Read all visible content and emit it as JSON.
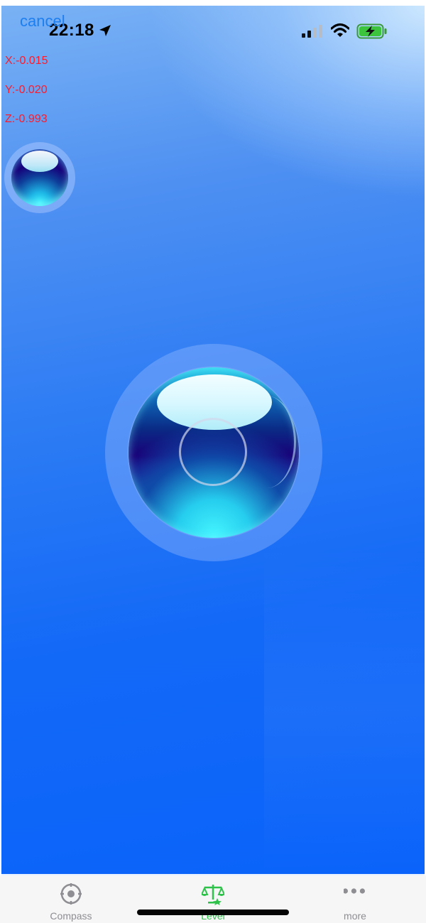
{
  "status_bar": {
    "time": "22:18",
    "location_icon": "location-arrow-icon",
    "signal_icon": "cellular-signal-icon",
    "wifi_icon": "wifi-icon",
    "battery_icon": "battery-charging-icon"
  },
  "header": {
    "cancel_label": "cancel"
  },
  "sensor": {
    "x_label": "X:-0.015",
    "y_label": "Y:-0.020",
    "z_label": "Z:-0.993",
    "x": -0.015,
    "y": -0.02,
    "z": -0.993
  },
  "tabs": [
    {
      "label": "Compass",
      "icon": "compass-target-icon",
      "selected": false
    },
    {
      "label": "Level",
      "icon": "balance-scale-icon",
      "selected": true
    },
    {
      "label": "more",
      "icon": "more-dots-icon",
      "selected": false
    }
  ],
  "colors": {
    "accent_link": "#1d7ff0",
    "readout_text": "#ff1a2a",
    "tab_selected": "#2fc24a",
    "tab_unselected": "#8e8e93"
  }
}
